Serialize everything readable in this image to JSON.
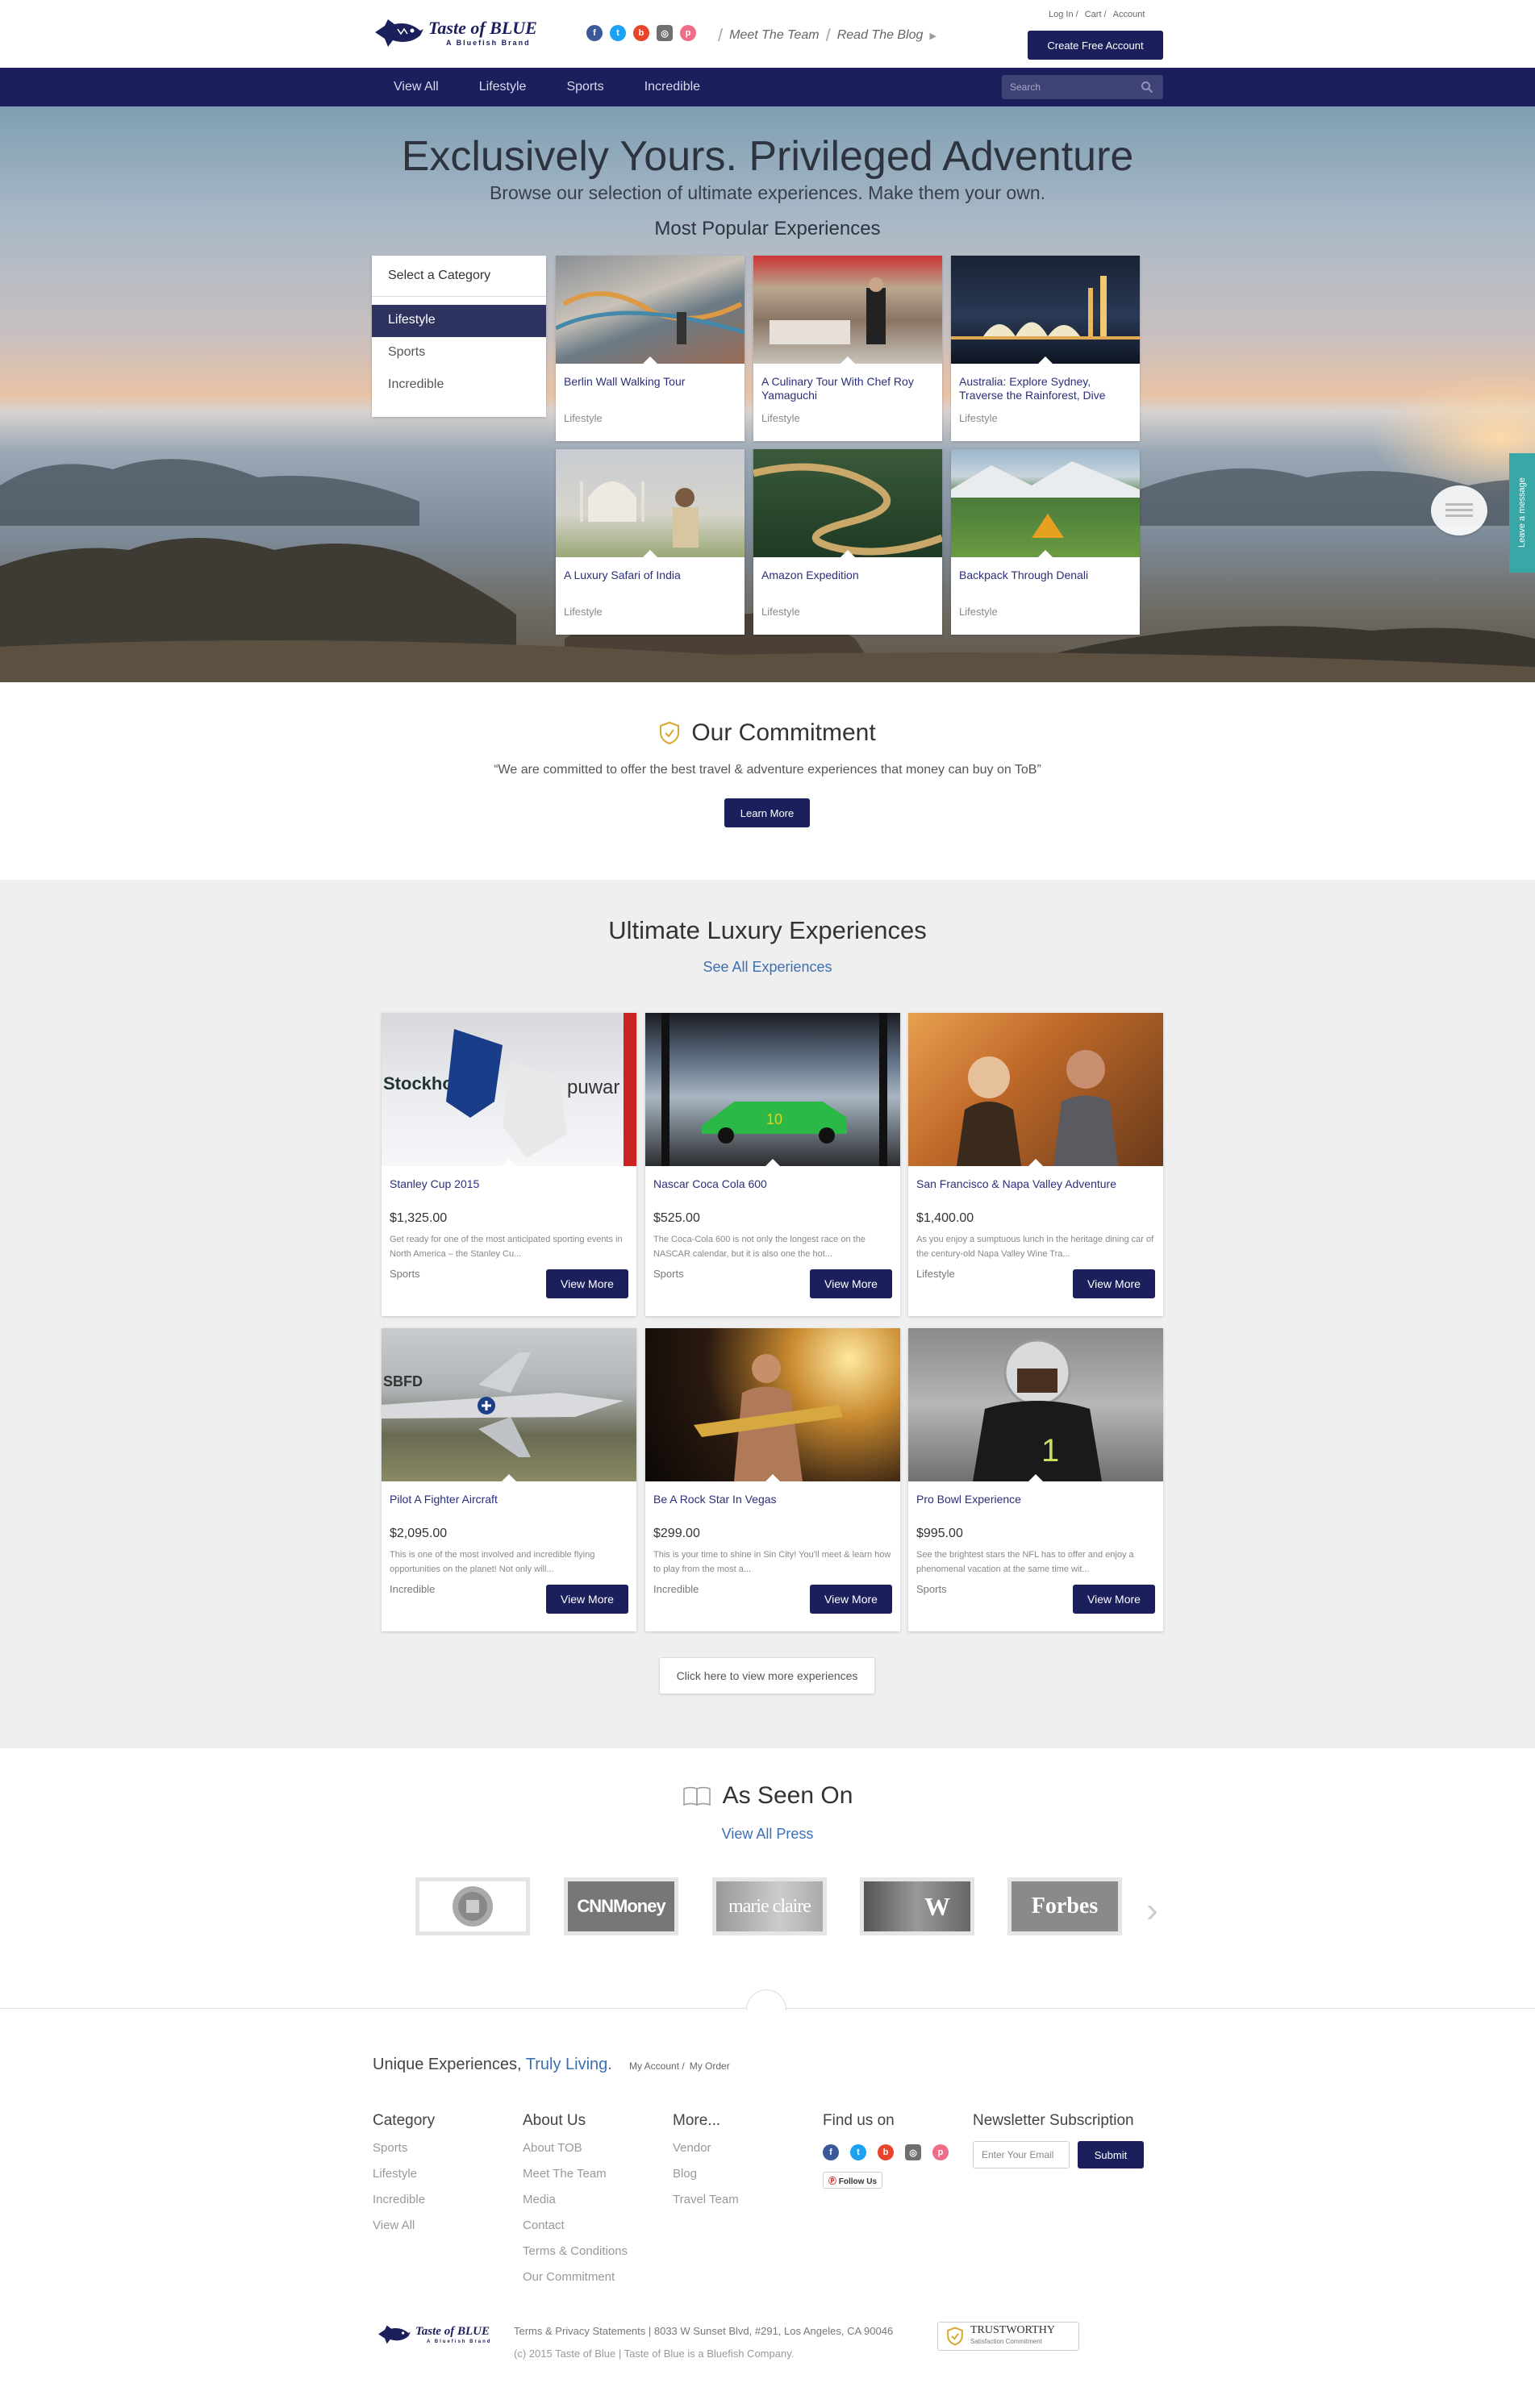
{
  "header": {
    "brand_name": "Taste of BLUE",
    "brand_tagline": "A Bluefish Brand",
    "links": [
      "Meet The Team",
      "Read The Blog"
    ],
    "account_links": [
      "Log In",
      "Cart",
      "Account"
    ],
    "create_account": "Create Free Account"
  },
  "nav": {
    "items": [
      "View All",
      "Lifestyle",
      "Sports",
      "Incredible"
    ],
    "search_placeholder": "Search"
  },
  "hero": {
    "title": "Exclusively Yours. Privileged Adventure",
    "subtitle": "Browse our selection of ultimate experiences. Make them your own.",
    "popular_heading": "Most Popular Experiences",
    "category_header": "Select a Category",
    "categories": [
      "Lifestyle",
      "Sports",
      "Incredible"
    ],
    "active_category": "Lifestyle",
    "cards": [
      {
        "title": "Berlin Wall Walking Tour",
        "category": "Lifestyle"
      },
      {
        "title": "A Culinary Tour With Chef Roy Yamaguchi",
        "category": "Lifestyle"
      },
      {
        "title": "Australia: Explore Sydney, Traverse the Rainforest, Dive",
        "category": "Lifestyle"
      },
      {
        "title": "A Luxury Safari of India",
        "category": "Lifestyle"
      },
      {
        "title": "Amazon Expedition",
        "category": "Lifestyle"
      },
      {
        "title": "Backpack Through Denali",
        "category": "Lifestyle"
      }
    ]
  },
  "commitment": {
    "title": "Our Commitment",
    "quote": "“We are committed to offer the best travel & adventure experiences that money can buy on ToB”",
    "button": "Learn More"
  },
  "ultimate": {
    "title": "Ultimate Luxury Experiences",
    "see_all": "See All Experiences",
    "button": "View More",
    "more_button": "Click here to view more experiences",
    "cards": [
      {
        "title": "Stanley Cup 2015",
        "price": "$1,325.00",
        "desc": "Get ready for one of the most anticipated sporting events in North America – the Stanley Cu...",
        "category": "Sports"
      },
      {
        "title": "Nascar Coca Cola 600",
        "price": "$525.00",
        "desc": "The Coca-Cola 600 is not only the longest race on the NASCAR calendar, but it is also one the hot...",
        "category": "Sports"
      },
      {
        "title": "San Francisco & Napa Valley Adventure",
        "price": "$1,400.00",
        "desc": "As you enjoy a sumptuous lunch in the heritage dining car of the century-old Napa Valley Wine Tra...",
        "category": "Lifestyle"
      },
      {
        "title": "Pilot A Fighter Aircraft",
        "price": "$2,095.00",
        "desc": "This is one of the most involved and incredible flying opportunities on the planet! Not only will...",
        "category": "Incredible"
      },
      {
        "title": "Be A Rock Star In Vegas",
        "price": "$299.00",
        "desc": "This is your time to shine in Sin City! You'll meet & learn how to play from the most a...",
        "category": "Incredible"
      },
      {
        "title": "Pro Bowl Experience",
        "price": "$995.00",
        "desc": "See the brightest stars the NFL has to offer and enjoy a phenomenal vacation at the same time wit...",
        "category": "Sports"
      }
    ]
  },
  "press": {
    "title": "As Seen On",
    "view_all": "View All Press",
    "logos": [
      "CNNMoney",
      "marie claire",
      "W",
      "Forbes"
    ]
  },
  "footer": {
    "tagline": "Unique Experiences,",
    "tagline_accent": "Truly Living.",
    "account_links": [
      "My Account",
      "My Order"
    ],
    "columns": [
      {
        "title": "Category",
        "links": [
          "Sports",
          "Lifestyle",
          "Incredible",
          "View All"
        ]
      },
      {
        "title": "About Us",
        "links": [
          "About TOB",
          "Meet The Team",
          "Media",
          "Contact",
          "Terms & Conditions",
          "Our Commitment"
        ]
      },
      {
        "title": "More...",
        "links": [
          "Vendor",
          "Blog",
          "Travel Team"
        ]
      }
    ],
    "find_us": "Find us on",
    "follow_us": "Follow Us",
    "newsletter_title": "Newsletter Subscription",
    "email_placeholder": "Enter Your Email",
    "submit": "Submit",
    "legal": "Terms & Privacy Statements | 8033 W Sunset Blvd, #291, Los Angeles, CA 90046",
    "copyright": "(c) 2015 Taste of Blue | Taste of Blue is a Bluefish Company.",
    "trust_title": "TRUSTWORTHY",
    "trust_sub": "Satisfaction Commitment"
  },
  "side": {
    "message_tab": "Leave a message"
  }
}
